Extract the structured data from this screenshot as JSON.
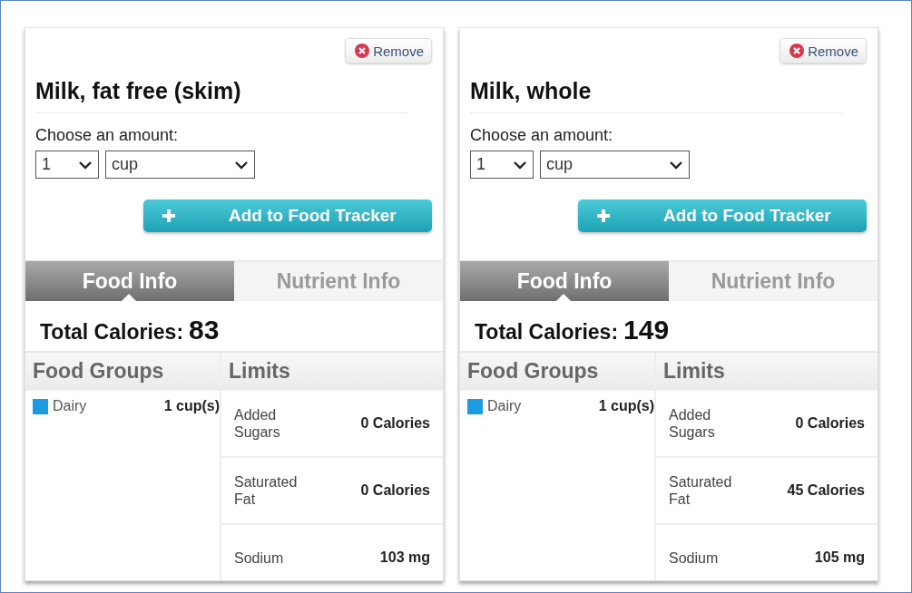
{
  "cards": [
    {
      "remove": "Remove",
      "title": "Milk, fat free (skim)",
      "amount_label": "Choose an amount:",
      "quantity": "1",
      "unit": "cup",
      "add_label": "Add to Food Tracker",
      "tabs": [
        {
          "label": "Food Info",
          "selected": true
        },
        {
          "label": "Nutrient Info",
          "selected": false
        }
      ],
      "total_label": "Total Calories:",
      "total_value": "83",
      "food_groups_header": "Food Groups",
      "limits_header": "Limits",
      "food_groups": [
        {
          "name": "Dairy",
          "color": "#1b9ce0",
          "amount": "1 cup(s)"
        }
      ],
      "limits": [
        {
          "name": "Added Sugars",
          "value": "0 Calories"
        },
        {
          "name": "Saturated Fat",
          "value": "0 Calories"
        },
        {
          "name": "Sodium",
          "value": "103 mg"
        }
      ]
    },
    {
      "remove": "Remove",
      "title": "Milk, whole",
      "amount_label": "Choose an amount:",
      "quantity": "1",
      "unit": "cup",
      "add_label": "Add to Food Tracker",
      "tabs": [
        {
          "label": "Food Info",
          "selected": true
        },
        {
          "label": "Nutrient Info",
          "selected": false
        }
      ],
      "total_label": "Total Calories:",
      "total_value": "149",
      "food_groups_header": "Food Groups",
      "limits_header": "Limits",
      "food_groups": [
        {
          "name": "Dairy",
          "color": "#1b9ce0",
          "amount": "1 cup(s)"
        }
      ],
      "limits": [
        {
          "name": "Added Sugars",
          "value": "0 Calories"
        },
        {
          "name": "Saturated Fat",
          "value": "45 Calories"
        },
        {
          "name": "Sodium",
          "value": "105 mg"
        }
      ]
    }
  ]
}
